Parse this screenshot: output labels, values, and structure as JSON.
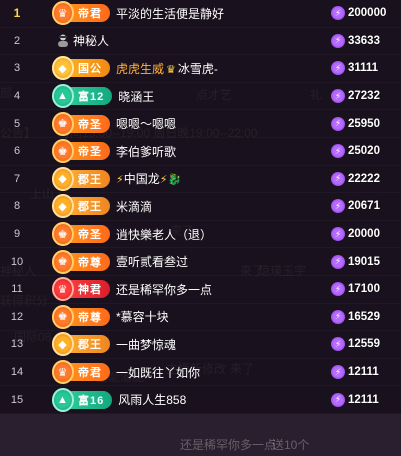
{
  "background_ghost_text": [
    "部",
    "公告】",
    "时间15:00--19:00 周日晚19:00--22:00",
    "点才艺",
    "礼",
    "上山",
    "来了",
    "来了",
    "琼瑛玉宇",
    "神秘人",
    "获得积分",
    "国际08",
    "全能潜能",
    "主播新修改",
    "来了",
    "送10个",
    "还是稀罕你多一点"
  ],
  "rows": [
    {
      "rank": "1",
      "rank_style": "big",
      "badge_label": "帝君",
      "badge_style": "orange",
      "badge_glyph": "♛",
      "name": "平淡的生活便是静好",
      "name_style": "",
      "score": "200000"
    },
    {
      "rank": "2",
      "rank_style": "",
      "badge_label": "",
      "badge_style": "",
      "badge_glyph": "",
      "avatar_icon": true,
      "name": "神秘人",
      "name_style": "",
      "score": "33633"
    },
    {
      "rank": "3",
      "rank_style": "",
      "badge_label": "国公",
      "badge_style": "gold",
      "badge_glyph": "◆",
      "name": "虎虎生威",
      "name_suffix": "冰雪虎-",
      "name_style": "gold-text",
      "crown": true,
      "score": "31111"
    },
    {
      "rank": "4",
      "rank_style": "",
      "badge_label": "富12",
      "badge_style": "teal",
      "badge_glyph": "▲",
      "name": "晓涵王",
      "name_style": "",
      "score": "27232"
    },
    {
      "rank": "5",
      "rank_style": "",
      "badge_label": "帝圣",
      "badge_style": "orange",
      "badge_glyph": "♚",
      "name": "嗯嗯～嗯嗯",
      "name_style": "",
      "score": "25950"
    },
    {
      "rank": "6",
      "rank_style": "",
      "badge_label": "帝圣",
      "badge_style": "orange",
      "badge_glyph": "♚",
      "name": "李伯爹听歌",
      "name_style": "",
      "score": "25020"
    },
    {
      "rank": "7",
      "rank_style": "",
      "badge_label": "郡王",
      "badge_style": "gold2",
      "badge_glyph": "◆",
      "name": "中国龙",
      "name_style": "",
      "bolt_deco": true,
      "score": "22222"
    },
    {
      "rank": "8",
      "rank_style": "",
      "badge_label": "郡王",
      "badge_style": "gold2",
      "badge_glyph": "◆",
      "name": "米滴滴",
      "name_style": "",
      "score": "20671"
    },
    {
      "rank": "9",
      "rank_style": "",
      "badge_label": "帝圣",
      "badge_style": "orange",
      "badge_glyph": "♚",
      "name": "逍快樂老人（退）",
      "name_style": "",
      "score": "20000"
    },
    {
      "rank": "10",
      "rank_style": "",
      "badge_label": "帝尊",
      "badge_style": "orange",
      "badge_glyph": "♚",
      "name": "壹听贰看叁过",
      "name_style": "",
      "score": "19015"
    },
    {
      "rank": "11",
      "rank_style": "",
      "badge_label": "神君",
      "badge_style": "red",
      "badge_glyph": "♛",
      "name": "还是稀罕你多一点",
      "name_style": "",
      "score": "17100"
    },
    {
      "rank": "12",
      "rank_style": "",
      "badge_label": "帝尊",
      "badge_style": "orange",
      "badge_glyph": "♚",
      "name": "*慕容十块",
      "name_style": "",
      "score": "16529"
    },
    {
      "rank": "13",
      "rank_style": "",
      "badge_label": "郡王",
      "badge_style": "gold2",
      "badge_glyph": "◆",
      "name": "一曲梦惊魂",
      "name_style": "",
      "score": "12559"
    },
    {
      "rank": "14",
      "rank_style": "",
      "badge_label": "帝君",
      "badge_style": "orange",
      "badge_glyph": "♛",
      "name": "一如既往丫如你",
      "name_style": "",
      "score": "12111"
    },
    {
      "rank": "15",
      "rank_style": "",
      "badge_label": "富16",
      "badge_style": "teal",
      "badge_glyph": "▲",
      "name": "风雨人生858",
      "name_style": "",
      "score": "12111"
    }
  ],
  "colors": {
    "background": "#2a1f2e",
    "score_icon": "#8a3fe8",
    "gold_text": "#ffb23b"
  },
  "icons": {
    "score": "lightning-bolt-icon",
    "avatar": "mystery-person-icon",
    "crown": "crown-icon"
  }
}
